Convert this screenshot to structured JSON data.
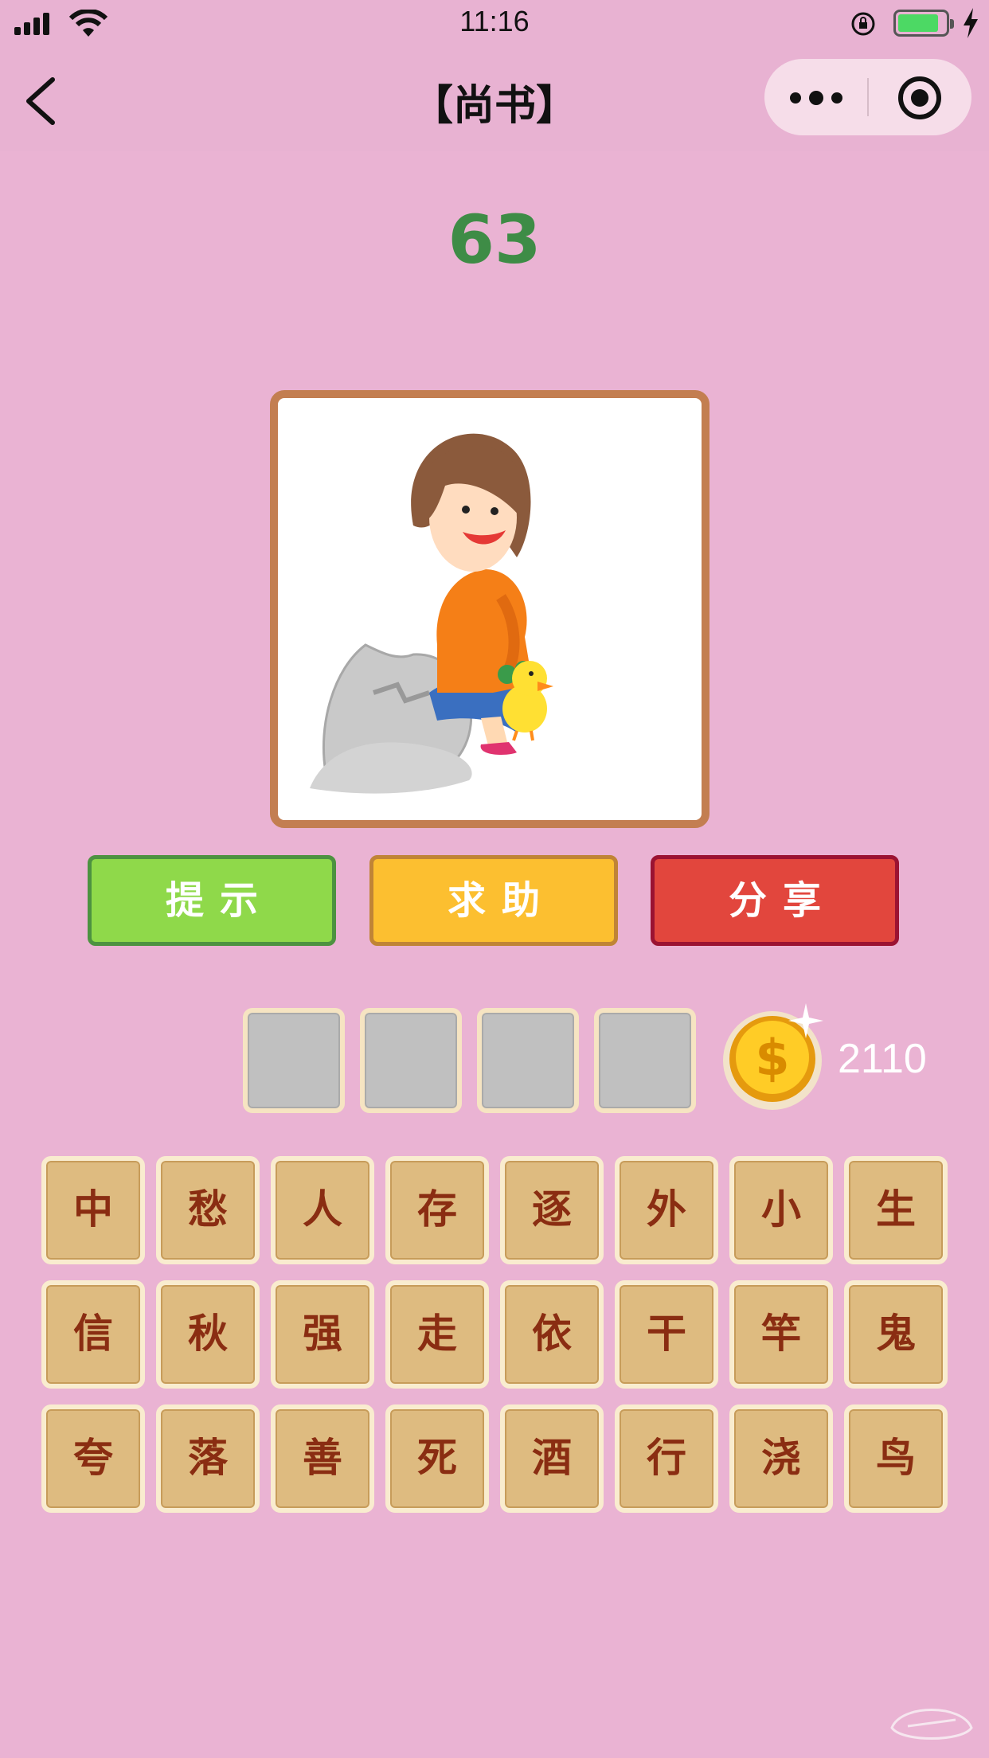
{
  "status_bar": {
    "time": "11:16"
  },
  "nav": {
    "title": "【尚书】"
  },
  "level": {
    "number": "63"
  },
  "actions": {
    "hint_label": "提示",
    "help_label": "求助",
    "share_label": "分享"
  },
  "coins": {
    "count": "2110"
  },
  "answer_slots": [
    "",
    "",
    "",
    ""
  ],
  "letter_grid": [
    [
      "中",
      "愁",
      "人",
      "存",
      "逐",
      "外",
      "小",
      "生"
    ],
    [
      "信",
      "秋",
      "强",
      "走",
      "依",
      "干",
      "竿",
      "鬼"
    ],
    [
      "夸",
      "落",
      "善",
      "死",
      "酒",
      "行",
      "浇",
      "鸟"
    ]
  ],
  "colors": {
    "background": "#e8b2d2",
    "level_number": "#3e8c46",
    "hint_button": "#8fd94a",
    "help_button": "#fcbf30",
    "share_button": "#e2463d",
    "tile": "#debb80",
    "tile_text": "#8a2d12"
  }
}
